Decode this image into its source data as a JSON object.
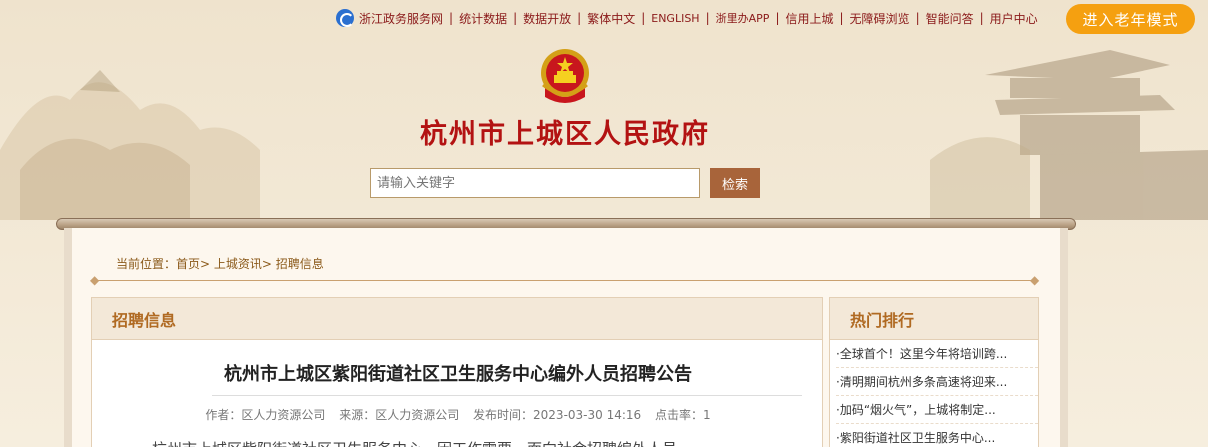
{
  "topbar": {
    "items": [
      "浙江政务服务网",
      "统计数据",
      "数据开放",
      "繁体中文",
      "ENGLISH",
      "浙里办APP",
      "信用上城",
      "无障碍浏览",
      "智能问答",
      "用户中心"
    ],
    "elder_mode": "进入老年模式"
  },
  "site": {
    "title": "杭州市上城区人民政府"
  },
  "search": {
    "placeholder": "请输入关键字",
    "button": "检索"
  },
  "breadcrumb": {
    "prefix": "当前位置：",
    "items": [
      "首页",
      "上城资讯",
      "招聘信息"
    ]
  },
  "main": {
    "section_title": "招聘信息",
    "article_title": "杭州市上城区紫阳街道社区卫生服务中心编外人员招聘公告",
    "meta": {
      "author": "作者：区人力资源公司",
      "source": "来源：区人力资源公司",
      "published": "发布时间：2023-03-30 14:16",
      "clicks": "点击率：1"
    },
    "body_start": "杭州市上城区紫阳街道社区卫生服务中心，因工作需要，面向社会招聘编外人员，"
  },
  "sidebar": {
    "title": "热门排行",
    "items": [
      "·全球首个！这里今年将培训跨...",
      "·清明期间杭州多条高速将迎来...",
      "·加码“烟火气”，上城将制定...",
      "·紫阳街道社区卫生服务中心..."
    ]
  },
  "colors": {
    "accent": "#b31212",
    "brand_orange": "#f5a010",
    "section_brown": "#b06a22"
  }
}
